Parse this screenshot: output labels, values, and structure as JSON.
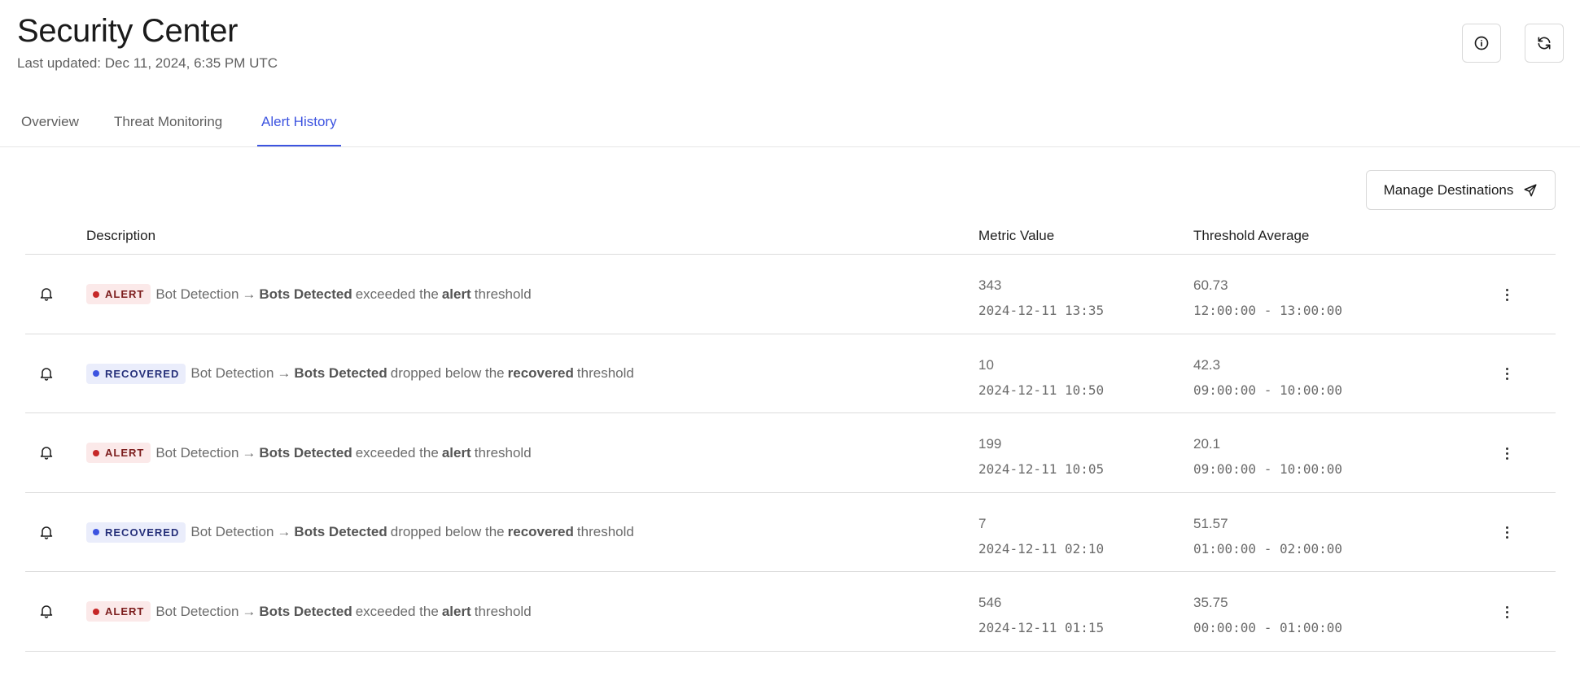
{
  "header": {
    "title": "Security Center",
    "last_updated": "Last updated: Dec 11, 2024, 6:35 PM UTC",
    "info_icon": "info-icon",
    "refresh_icon": "refresh-icon"
  },
  "tabs": [
    {
      "label": "Overview",
      "active": false
    },
    {
      "label": "Threat Monitoring",
      "active": false
    },
    {
      "label": "Alert History",
      "active": true
    }
  ],
  "actions": {
    "manage_destinations_label": "Manage Destinations",
    "manage_destinations_icon": "send-icon"
  },
  "colors": {
    "accent": "#3d54e0",
    "alert_bg": "#fbe9e9",
    "alert_text": "#7c1d1d",
    "alert_dot": "#c62828",
    "recovered_bg": "#eaedfb",
    "recovered_text": "#26307a",
    "recovered_dot": "#3d54e0"
  },
  "table": {
    "columns": {
      "description": "Description",
      "metric_value": "Metric Value",
      "threshold_average": "Threshold Average"
    },
    "rows": [
      {
        "status": "ALERT",
        "source": "Bot Detection",
        "arrow": "→",
        "metric": "Bots Detected",
        "verb": "exceeded the",
        "level": "alert",
        "suffix": "threshold",
        "value": "343",
        "timestamp": "2024-12-11 13:35",
        "threshold": "60.73",
        "window": "12:00:00 - 13:00:00"
      },
      {
        "status": "RECOVERED",
        "source": "Bot Detection",
        "arrow": "→",
        "metric": "Bots Detected",
        "verb": "dropped below the",
        "level": "recovered",
        "suffix": "threshold",
        "value": "10",
        "timestamp": "2024-12-11 10:50",
        "threshold": "42.3",
        "window": "09:00:00 - 10:00:00"
      },
      {
        "status": "ALERT",
        "source": "Bot Detection",
        "arrow": "→",
        "metric": "Bots Detected",
        "verb": "exceeded the",
        "level": "alert",
        "suffix": "threshold",
        "value": "199",
        "timestamp": "2024-12-11 10:05",
        "threshold": "20.1",
        "window": "09:00:00 - 10:00:00"
      },
      {
        "status": "RECOVERED",
        "source": "Bot Detection",
        "arrow": "→",
        "metric": "Bots Detected",
        "verb": "dropped below the",
        "level": "recovered",
        "suffix": "threshold",
        "value": "7",
        "timestamp": "2024-12-11 02:10",
        "threshold": "51.57",
        "window": "01:00:00 - 02:00:00"
      },
      {
        "status": "ALERT",
        "source": "Bot Detection",
        "arrow": "→",
        "metric": "Bots Detected",
        "verb": "exceeded the",
        "level": "alert",
        "suffix": "threshold",
        "value": "546",
        "timestamp": "2024-12-11 01:15",
        "threshold": "35.75",
        "window": "00:00:00 - 01:00:00"
      }
    ]
  }
}
